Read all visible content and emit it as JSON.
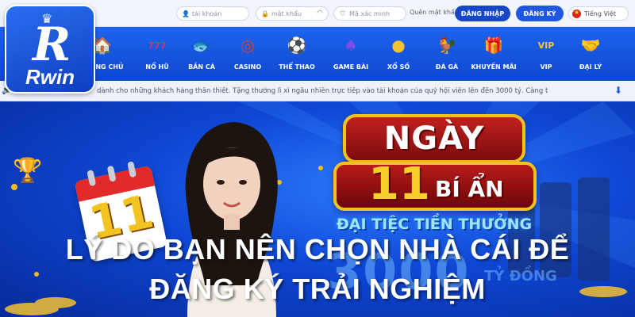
{
  "login": {
    "username_placeholder": "tài khoản",
    "password_placeholder": "mật khẩu",
    "captcha_placeholder": "Mã xác minh",
    "forgot_label": "Quên mật khẩu",
    "login_button": "ĐĂNG NHẬP",
    "register_button": "ĐĂNG KÝ",
    "language": "Tiếng Việt"
  },
  "logo": {
    "brand": "Rwin",
    "letter": "R"
  },
  "nav": {
    "items": [
      {
        "label": "TRANG CHỦ",
        "icon": "home-icon",
        "glyph": "🏠",
        "color": "#f08a2c"
      },
      {
        "label": "NỔ HŨ",
        "icon": "jackpot-icon",
        "glyph": "777",
        "color": "#e0306a"
      },
      {
        "label": "BẮN CÁ",
        "icon": "fish-icon",
        "glyph": "🐟",
        "color": "#3aa0f0"
      },
      {
        "label": "CASINO",
        "icon": "roulette-icon",
        "glyph": "◎",
        "color": "#d9452a"
      },
      {
        "label": "THỂ THAO",
        "icon": "soccer-ball-icon",
        "glyph": "⚽",
        "color": "#ffffff"
      },
      {
        "label": "GAME BÀI",
        "icon": "cards-icon",
        "glyph": "♠",
        "color": "#7b4ee6"
      },
      {
        "label": "XỔ SỐ",
        "icon": "lottery-icon",
        "glyph": "●",
        "color": "#f2c230"
      },
      {
        "label": "ĐÁ GÀ",
        "icon": "rooster-icon",
        "glyph": "🐓",
        "color": "#e24a3a"
      },
      {
        "label": "KHUYẾN MÃI",
        "icon": "gift-icon",
        "glyph": "🎁",
        "color": "#e85aa0"
      },
      {
        "label": "VIP",
        "icon": "vip-icon",
        "glyph": "VIP",
        "color": "#f5c430"
      },
      {
        "label": "ĐẠI LÝ",
        "icon": "agent-icon",
        "glyph": "🤝",
        "color": "#3a8cf0"
      }
    ]
  },
  "marquee": {
    "text": "dành cho những khách hàng thân thiết. Tặng thưởng lì xì ngẫu nhiên trực tiếp vào tài khoản của quý hội viên lên đến 3000 tỷ. Càng t"
  },
  "banner": {
    "sign_line1": "NGÀY",
    "sign_number": "11",
    "sign_line2": "BÍ ẨN",
    "subtitle": "ĐẠI TIỆC TIỀN THƯỞNG",
    "amount": "3000",
    "amount_unit": "TỶ ĐỒNG",
    "calendar_number": "11"
  },
  "headline": {
    "line1": "LÝ DO BẠN NÊN CHỌN NHÀ CÁI ĐỂ",
    "line2": "ĐĂNG KÝ TRẢI NGHIỆM"
  }
}
